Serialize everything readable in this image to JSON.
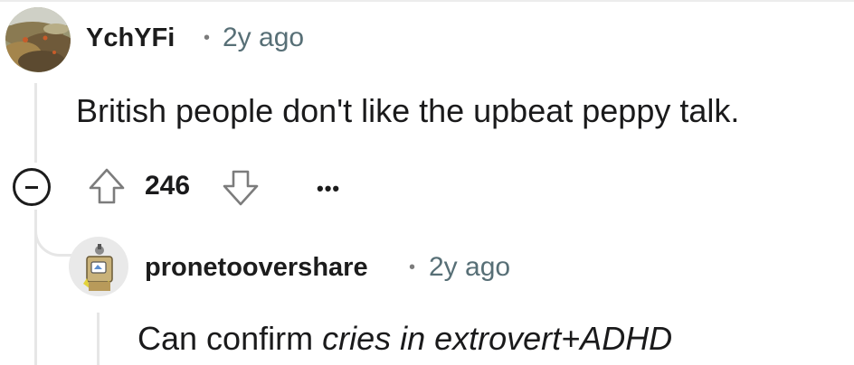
{
  "comment": {
    "username": "YchYFi",
    "separator": "•",
    "time": "2y ago",
    "body": "British people don't like the upbeat peppy talk.",
    "score": "246",
    "more_label": "•••",
    "icons": {
      "collapse": "collapse-minus-icon",
      "upvote": "upvote-arrow-icon",
      "downvote": "downvote-arrow-icon"
    }
  },
  "reply": {
    "username": "pronetoovershare",
    "separator": "•",
    "time": "2y ago",
    "body_plain": "Can confirm ",
    "body_italic": "cries in extrovert+ADHD"
  },
  "colors": {
    "thread_line": "#e6e6e6",
    "meta_text": "#576f76",
    "text": "#1a1a1b"
  }
}
